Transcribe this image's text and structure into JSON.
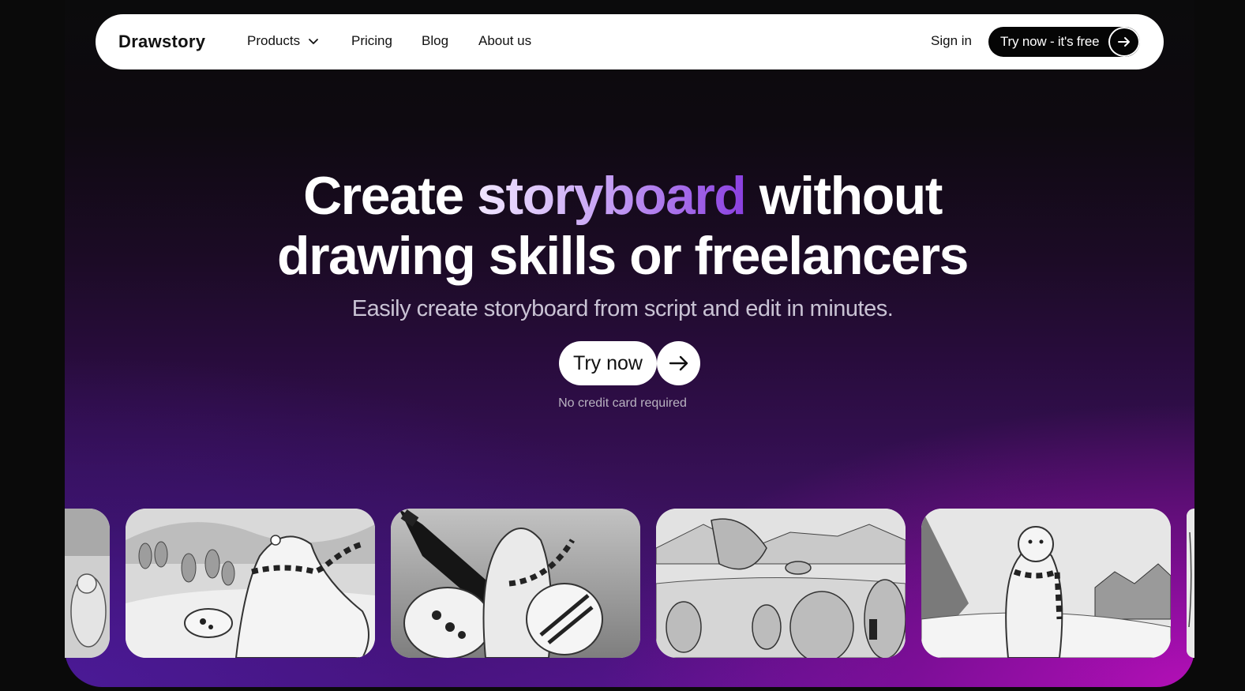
{
  "nav": {
    "logo": "Drawstory",
    "products": "Products",
    "pricing": "Pricing",
    "blog": "Blog",
    "about": "About us",
    "sign_in": "Sign in",
    "try_free": "Try now - it's free"
  },
  "hero": {
    "headline_part1": "Create ",
    "headline_accent": "storyboard",
    "headline_part2": " without",
    "headline_line2": "drawing skills or freelancers",
    "subtitle": "Easily create storyboard from script and edit in minutes.",
    "cta": "Try now",
    "note": "No credit card required"
  },
  "colors": {
    "accent_start": "#f1e6ff",
    "accent_end": "#8a3fe0",
    "gradient_magenta": "#b30fb6",
    "gradient_purple": "#4a1a96"
  },
  "gallery": {
    "images": [
      "storyboard-bear-sitting",
      "storyboard-bear-scarf-skating",
      "storyboard-bear-cola-bottle",
      "storyboard-bears-glacier",
      "storyboard-bear-standing",
      "storyboard-partial"
    ]
  }
}
